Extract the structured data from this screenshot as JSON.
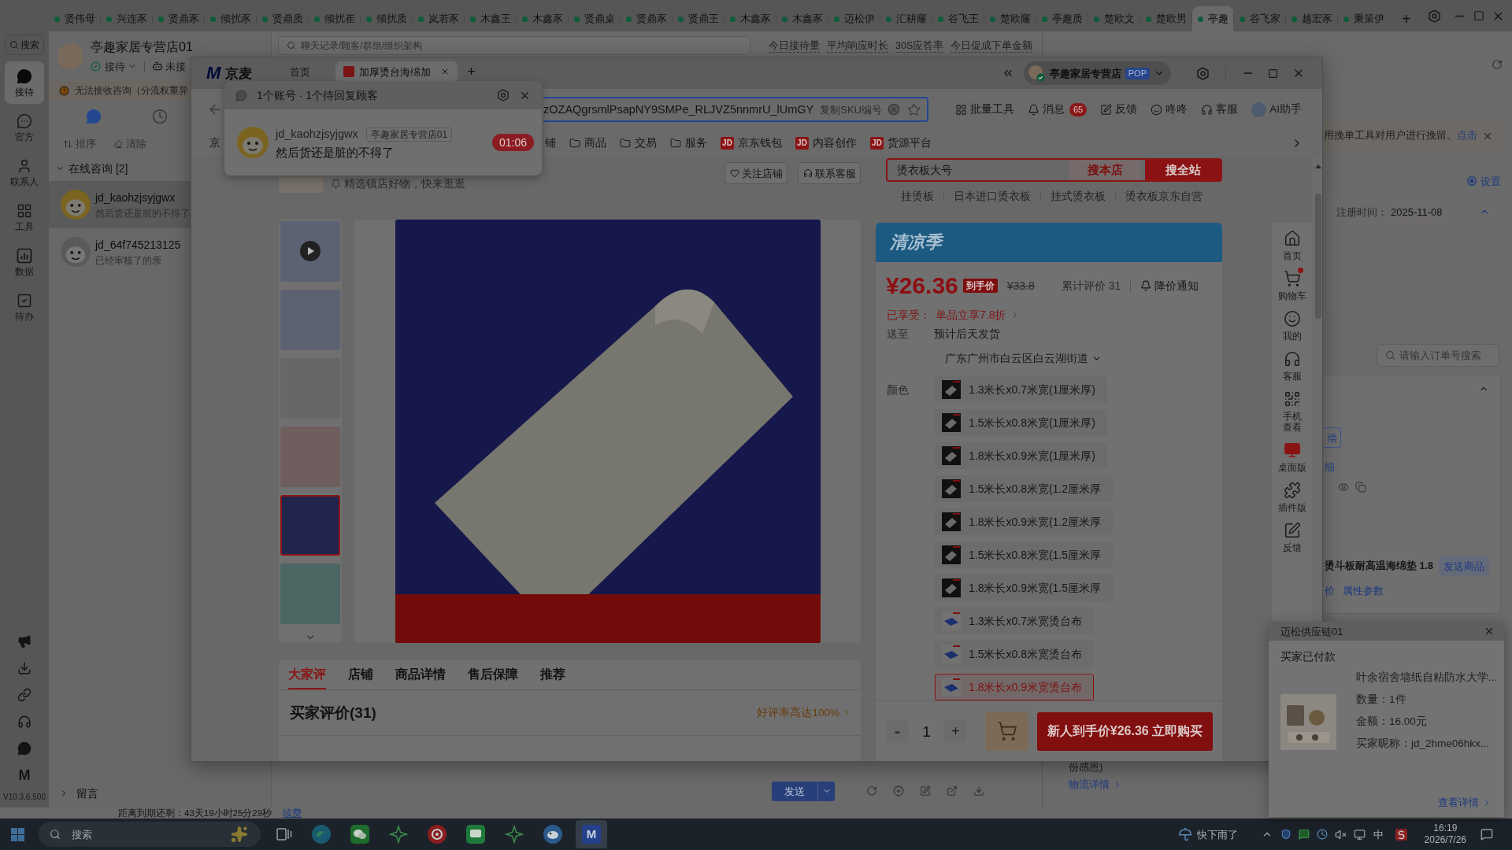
{
  "app_tabs": {
    "items": [
      {
        "label": "贤伟母",
        "selected": false
      },
      {
        "label": "兴连豕",
        "selected": false
      },
      {
        "label": "贤鼎豕",
        "selected": false
      },
      {
        "label": "倾扰豕",
        "selected": false
      },
      {
        "label": "贤鼎质",
        "selected": false
      },
      {
        "label": "倾扰崔",
        "selected": false
      },
      {
        "label": "倾扰质",
        "selected": false
      },
      {
        "label": "岚若豕",
        "selected": false
      },
      {
        "label": "木鑫王",
        "selected": false
      },
      {
        "label": "木鑫豕",
        "selected": false
      },
      {
        "label": "贤鼎桌",
        "selected": false
      },
      {
        "label": "贤鼎豕",
        "selected": false
      },
      {
        "label": "贤鼎王",
        "selected": false
      },
      {
        "label": "木鑫豕",
        "selected": false
      },
      {
        "label": "木鑫豕",
        "selected": false
      },
      {
        "label": "迈松伊",
        "selected": false
      },
      {
        "label": "汇耕窿",
        "selected": false
      },
      {
        "label": "谷飞王",
        "selected": false
      },
      {
        "label": "楚欧窿",
        "selected": false
      },
      {
        "label": "亭趣质",
        "selected": false
      },
      {
        "label": "楚欧文",
        "selected": false
      },
      {
        "label": "楚欧男",
        "selected": false
      },
      {
        "label": "亭趣",
        "selected": true
      },
      {
        "label": "谷飞家",
        "selected": false
      },
      {
        "label": "越宏豕",
        "selected": false
      },
      {
        "label": "秉策伊",
        "selected": false
      }
    ],
    "add_label": "+"
  },
  "nav_rail": {
    "search_label": "搜索",
    "items": [
      {
        "label": "接待",
        "selected": true
      },
      {
        "label": "官方",
        "selected": false
      },
      {
        "label": "联系人",
        "selected": false
      },
      {
        "label": "工具",
        "selected": false
      },
      {
        "label": "数据",
        "selected": false
      },
      {
        "label": "待办",
        "selected": false
      }
    ],
    "logo_text": "M",
    "version": "V10.3.6.500"
  },
  "chat_list": {
    "store_name": "亭趣家居专营店01",
    "status": "接待",
    "secondary_status": "未接",
    "warning": "无法接收咨询（分流权重异",
    "view_tabs": [
      {
        "selected": true
      },
      {
        "selected": false
      }
    ],
    "sort_label": "排序",
    "clear_label": "清除",
    "section": {
      "title": "在线咨询 [2]",
      "expanded": true
    },
    "conversations": [
      {
        "name": "jd_kaohzjsyjgwx",
        "preview": "然后货还是脏的不得了",
        "selected": true,
        "online": true
      },
      {
        "name": "jd_64f745213125",
        "preview": "已经审核了的亲",
        "selected": false,
        "online": false
      }
    ],
    "footer_label": "留言"
  },
  "chat_pane": {
    "search_placeholder": "聊天记录/顾客/群组/组织架构",
    "stats": [
      "今日接待量",
      "平均响应时长",
      "30S应答率",
      "今日促成下单金额"
    ],
    "send_label": "发送"
  },
  "expiry_bar": {
    "text": "距离到期还剩：43天19小时25分29秒",
    "link": "续费"
  },
  "right_panel": {
    "notice": "用挽单工具对用户进行挽留。",
    "notice_link": "点击",
    "settings_label": "设置",
    "settings_checked": true,
    "registration_label": "注册时间：",
    "registration_value": "2025-11-08",
    "order_search_placeholder": "请输入订单号搜索",
    "compensation_fragment": "偿",
    "detail_fragment": "细",
    "product_name": "烫斗板耐高温海绵垫 1.8",
    "send_product_label": "发送商品",
    "links": [
      "价",
      "属性参数"
    ],
    "note": "份感恩)",
    "logistics_link": "物流详情"
  },
  "browser_window": {
    "logo_mark": "M",
    "logo_text": "京麦",
    "tabs": [
      {
        "label": "首页",
        "kind": "home",
        "selected": false
      },
      {
        "label": "加厚烫台海绵加",
        "kind": "page",
        "selected": true
      }
    ],
    "add_tab_label": "+",
    "account": {
      "name": "亭趣家居专营店",
      "badge": "POP"
    },
    "address": {
      "value": "zOZAQgrsmlPsapNY9SMPe_RLJVZ5nnmrU_lUmGY",
      "copy_label": "复制SKU编号"
    },
    "tools": [
      {
        "label": "批量工具"
      },
      {
        "label": "消息",
        "count": "65"
      },
      {
        "label": "反馈"
      },
      {
        "label": "咚咚"
      },
      {
        "label": "客服"
      },
      {
        "label": "AI助手"
      }
    ],
    "bookmarks": [
      {
        "label": "京",
        "kind": "plain"
      },
      {
        "label": "铺",
        "kind": "plain"
      },
      {
        "label": "商品",
        "kind": "folder"
      },
      {
        "label": "交易",
        "kind": "folder"
      },
      {
        "label": "服务",
        "kind": "folder"
      },
      {
        "label": "京东钱包",
        "kind": "jd",
        "badge": "JD"
      },
      {
        "label": "内容创作",
        "kind": "jd",
        "badge": "JD"
      },
      {
        "label": "货源平台",
        "kind": "jd",
        "badge": "JD"
      }
    ]
  },
  "product_page": {
    "store": {
      "slogan": "精选镇店好物，快来逛逛",
      "follow_label": "关注店铺",
      "contact_label": "联系客服"
    },
    "search": {
      "value": "烫衣板大号",
      "store_button": "搜本店",
      "site_button": "搜全站",
      "suggestions": [
        "挂烫板",
        "日本进口烫衣板",
        "挂式烫衣板",
        "烫衣板京东自营"
      ]
    },
    "gallery": [
      {
        "kind": "video",
        "selected": false
      },
      {
        "kind": "photo",
        "selected": false
      },
      {
        "kind": "photo",
        "selected": false
      },
      {
        "kind": "photo",
        "selected": false
      },
      {
        "kind": "photo",
        "selected": true
      },
      {
        "kind": "photo",
        "selected": false
      }
    ],
    "tabs": [
      {
        "label": "大家评",
        "selected": true
      },
      {
        "label": "店铺",
        "selected": false
      },
      {
        "label": "商品详情",
        "selected": false
      },
      {
        "label": "售后保障",
        "selected": false
      },
      {
        "label": "推荐",
        "selected": false
      }
    ],
    "reviews": {
      "title": "买家评价(31)",
      "rating_link": "好评率高达100%"
    },
    "promo_banner": "清凉季",
    "price": {
      "current": "¥26.36",
      "badge": "到手价",
      "original": "¥33.8",
      "review_count": "累计评价 31",
      "alert_label": "降价通知"
    },
    "discount": {
      "label": "已享受：",
      "value": "单品立享7.8折"
    },
    "delivery": {
      "label": "送至",
      "estimate": "预计后天发货",
      "address": "广东广州市白云区白云湖街道"
    },
    "color": {
      "label": "颜色",
      "options": [
        {
          "label": "1.3米长x0.7米宽(1厘米厚)",
          "kind": "sponge",
          "selected": false
        },
        {
          "label": "1.5米长x0.8米宽(1厘米厚)",
          "kind": "sponge",
          "selected": false
        },
        {
          "label": "1.8米长x0.9米宽(1厘米厚)",
          "kind": "sponge",
          "selected": false
        },
        {
          "label": "1.5米长x0.8米宽(1.2厘米厚",
          "kind": "sponge",
          "selected": false
        },
        {
          "label": "1.8米长x0.9米宽(1.2厘米厚",
          "kind": "sponge",
          "selected": false
        },
        {
          "label": "1.5米长x0.8米宽(1.5厘米厚",
          "kind": "sponge",
          "selected": false
        },
        {
          "label": "1.8米长x0.9米宽(1.5厘米厚",
          "kind": "sponge",
          "selected": false
        },
        {
          "label": "1.3米长x0.7米宽烫台布",
          "kind": "cloth",
          "selected": false
        },
        {
          "label": "1.5米长x0.8米宽烫台布",
          "kind": "cloth",
          "selected": false
        },
        {
          "label": "1.8米长x0.9米宽烫台布",
          "kind": "cloth",
          "selected": true
        }
      ]
    },
    "quantity": {
      "decrement": "-",
      "value": "1",
      "increment": "+",
      "decrement_disabled": true
    },
    "buy_button": "新人到手价¥26.36 立即购买",
    "side_nav": [
      {
        "label": "首页",
        "dot": false
      },
      {
        "label": "购物车",
        "dot": true
      },
      {
        "label": "我的",
        "dot": false
      },
      {
        "label": "客服",
        "dot": false
      },
      {
        "label": "手机查看",
        "dot": false
      },
      {
        "label": "桌面版",
        "dot": false
      },
      {
        "label": "插件版",
        "dot": false
      },
      {
        "label": "反馈",
        "dot": false
      }
    ]
  },
  "reply_popup": {
    "title": "1个账号 · 1个待回复顾客",
    "customer": "jd_kaohzjsyjgwx",
    "store_tag": "亭趣家居专营店01",
    "message": "然后货还是脏的不得了",
    "timer": "01:06"
  },
  "order_popup": {
    "title": "迈松供应链01",
    "status": "买家已付款",
    "product": "叶余宿舍墙纸自粘防水大学...",
    "quantity": "数量：1件",
    "amount": "金额：16.00元",
    "buyer": "买家昵称：jd_2hme06hkx...",
    "detail_link": "查看详情"
  },
  "taskbar": {
    "search_placeholder": "搜索",
    "app_logo_text": "M",
    "weather": "快下雨了",
    "ime": "中",
    "time": "16:19",
    "date": "2026/7/26"
  }
}
